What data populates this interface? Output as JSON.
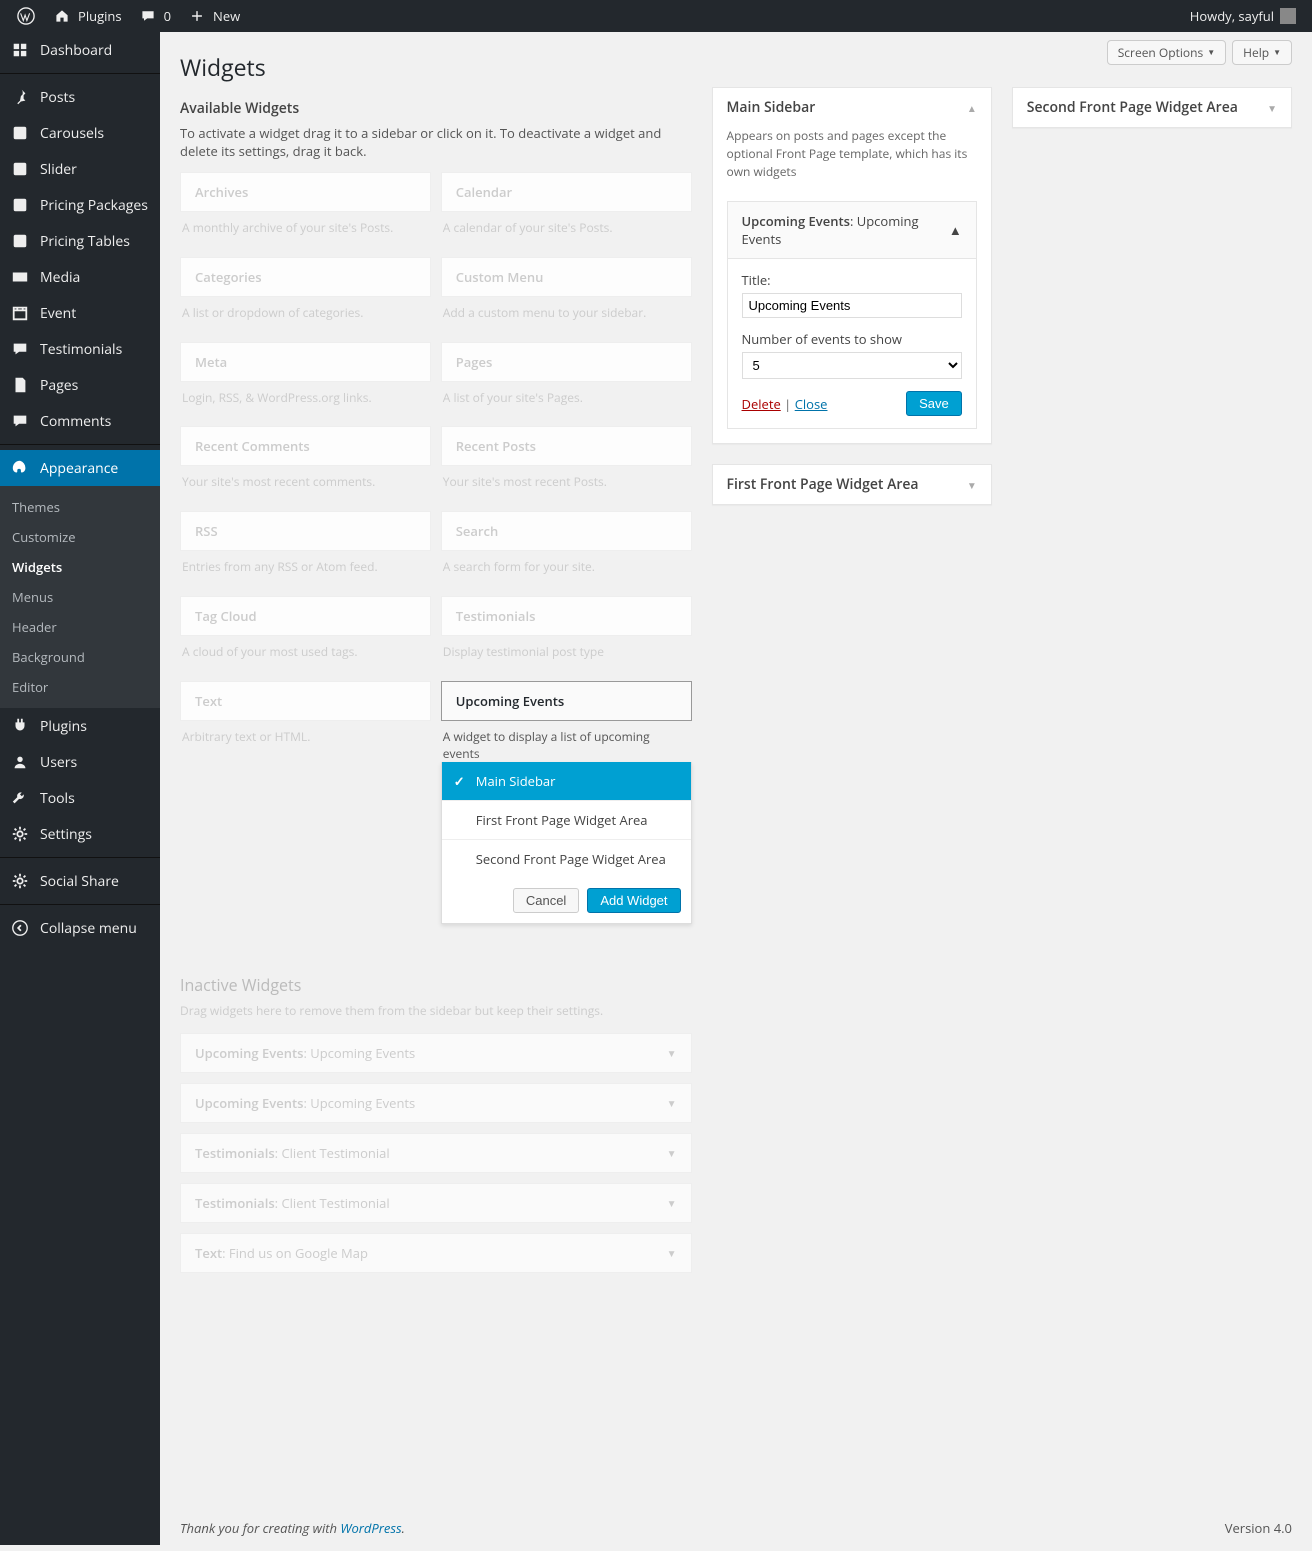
{
  "adminbar": {
    "site": "Plugins",
    "comments": "0",
    "new": "New",
    "howdy": "Howdy, sayful"
  },
  "sidebar": {
    "items": [
      {
        "label": "Dashboard",
        "icon": "dashboard"
      },
      {
        "label": "Posts",
        "icon": "pin"
      },
      {
        "label": "Carousels",
        "icon": "generic"
      },
      {
        "label": "Slider",
        "icon": "generic"
      },
      {
        "label": "Pricing Packages",
        "icon": "generic"
      },
      {
        "label": "Pricing Tables",
        "icon": "generic"
      },
      {
        "label": "Media",
        "icon": "media"
      },
      {
        "label": "Event",
        "icon": "calendar"
      },
      {
        "label": "Testimonials",
        "icon": "comment"
      },
      {
        "label": "Pages",
        "icon": "page"
      },
      {
        "label": "Comments",
        "icon": "comment"
      },
      {
        "label": "Appearance",
        "icon": "appearance",
        "current": true
      },
      {
        "label": "Plugins",
        "icon": "plugin"
      },
      {
        "label": "Users",
        "icon": "user"
      },
      {
        "label": "Tools",
        "icon": "tool"
      },
      {
        "label": "Settings",
        "icon": "settings"
      },
      {
        "label": "Social Share",
        "icon": "settings"
      },
      {
        "label": "Collapse menu",
        "icon": "collapse"
      }
    ],
    "submenu": [
      {
        "label": "Themes"
      },
      {
        "label": "Customize"
      },
      {
        "label": "Widgets",
        "current": true
      },
      {
        "label": "Menus"
      },
      {
        "label": "Header"
      },
      {
        "label": "Background"
      },
      {
        "label": "Editor"
      }
    ]
  },
  "screen": {
    "options": "Screen Options",
    "help": "Help"
  },
  "page": {
    "title": "Widgets",
    "available_title": "Available Widgets",
    "available_desc": "To activate a widget drag it to a sidebar or click on it. To deactivate a widget and delete its settings, drag it back.",
    "inactive_title": "Inactive Widgets",
    "inactive_desc": "Drag widgets here to remove them from the sidebar but keep their settings."
  },
  "widgets": [
    {
      "name": "Archives",
      "desc": "A monthly archive of your site's Posts."
    },
    {
      "name": "Calendar",
      "desc": "A calendar of your site's Posts."
    },
    {
      "name": "Categories",
      "desc": "A list or dropdown of categories."
    },
    {
      "name": "Custom Menu",
      "desc": "Add a custom menu to your sidebar."
    },
    {
      "name": "Meta",
      "desc": "Login, RSS, & WordPress.org links."
    },
    {
      "name": "Pages",
      "desc": "A list of your site's Pages."
    },
    {
      "name": "Recent Comments",
      "desc": "Your site's most recent comments."
    },
    {
      "name": "Recent Posts",
      "desc": "Your site's most recent Posts."
    },
    {
      "name": "RSS",
      "desc": "Entries from any RSS or Atom feed."
    },
    {
      "name": "Search",
      "desc": "A search form for your site."
    },
    {
      "name": "Tag Cloud",
      "desc": "A cloud of your most used tags."
    },
    {
      "name": "Testimonials",
      "desc": "Display testimonial post type"
    },
    {
      "name": "Text",
      "desc": "Arbitrary text or HTML."
    },
    {
      "name": "Upcoming Events",
      "desc": "A widget to display a list of upcoming events",
      "active": true
    }
  ],
  "chooser": {
    "options": [
      {
        "label": "Main Sidebar",
        "selected": true
      },
      {
        "label": "First Front Page Widget Area"
      },
      {
        "label": "Second Front Page Widget Area"
      }
    ],
    "cancel": "Cancel",
    "add": "Add Widget"
  },
  "sidebars": {
    "main": {
      "title": "Main Sidebar",
      "desc": "Appears on posts and pages except the optional Front Page template, which has its own widgets",
      "widget": {
        "name": "Upcoming Events",
        "instance_title": "Upcoming Events",
        "field_title_label": "Title:",
        "field_title_value": "Upcoming Events",
        "field_num_label": "Number of events to show",
        "field_num_value": "5",
        "delete": "Delete",
        "close": "Close",
        "save": "Save"
      }
    },
    "first": {
      "title": "First Front Page Widget Area"
    },
    "second": {
      "title": "Second Front Page Widget Area"
    }
  },
  "inactive": [
    {
      "name": "Upcoming Events",
      "title": "Upcoming Events"
    },
    {
      "name": "Upcoming Events",
      "title": "Upcoming Events"
    },
    {
      "name": "Testimonials",
      "title": "Client Testimonial"
    },
    {
      "name": "Testimonials",
      "title": "Client Testimonial"
    },
    {
      "name": "Text",
      "title": "Find us on Google Map"
    }
  ],
  "footer": {
    "thanks_prefix": "Thank you for creating with ",
    "wp": "WordPress",
    "suffix": ".",
    "version": "Version 4.0"
  }
}
